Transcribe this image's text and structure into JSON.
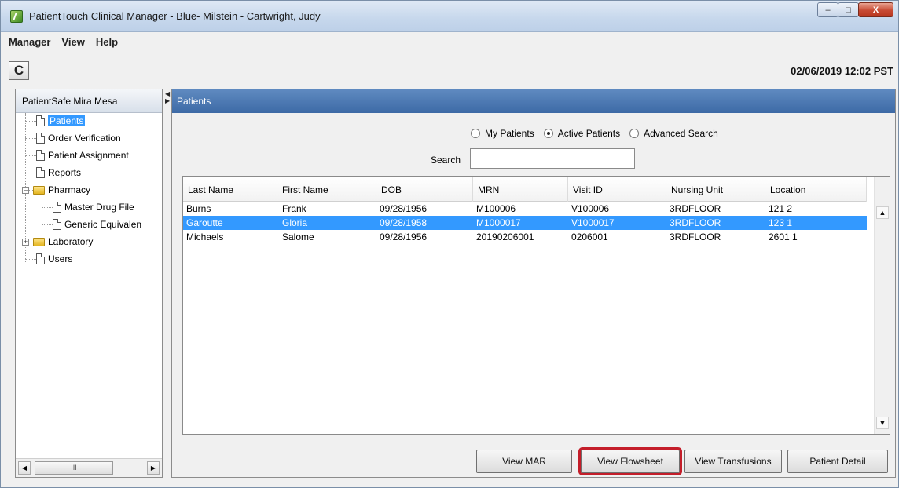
{
  "window": {
    "title": "PatientTouch Clinical Manager - Blue- Milstein - Cartwright, Judy",
    "minimize": "–",
    "maximize": "□",
    "close": "X"
  },
  "menu": {
    "manager": "Manager",
    "view": "View",
    "help": "Help"
  },
  "toolbar": {
    "refresh_glyph": "C",
    "datetime": "02/06/2019 12:02 PST"
  },
  "nav": {
    "header": "PatientSafe Mira Mesa",
    "items": [
      {
        "label": "Patients",
        "selected": true
      },
      {
        "label": "Order Verification"
      },
      {
        "label": "Patient Assignment"
      },
      {
        "label": "Reports"
      },
      {
        "label": "Pharmacy",
        "expander": "–"
      },
      {
        "label": "Master Drug File"
      },
      {
        "label": "Generic Equivalen"
      },
      {
        "label": "Laboratory",
        "expander": "+"
      },
      {
        "label": "Users"
      }
    ],
    "scroll_thumb": "III",
    "scroll_left": "◀",
    "scroll_right": "▶"
  },
  "patients": {
    "header": "Patients",
    "radio": {
      "my_patients": "My Patients",
      "active_patients": "Active Patients",
      "advanced_search": "Advanced Search",
      "selected": "active_patients"
    },
    "search_label": "Search",
    "search_value": "",
    "columns": [
      "Last Name",
      "First Name",
      "DOB",
      "MRN",
      "Visit ID",
      "Nursing Unit",
      "Location"
    ],
    "rows": [
      [
        "Burns",
        "Frank",
        "09/28/1956",
        "M100006",
        "V100006",
        "3RDFLOOR",
        "121 2"
      ],
      [
        "Garoutte",
        "Gloria",
        "09/28/1958",
        "M1000017",
        "V1000017",
        "3RDFLOOR",
        "123 1"
      ],
      [
        "Michaels",
        "Salome",
        "09/28/1956",
        "20190206001",
        "0206001",
        "3RDFLOOR",
        "2601 1"
      ]
    ],
    "selected_row": 1,
    "scroll_up": "▲",
    "scroll_down": "▼"
  },
  "buttons": {
    "view_mar": "View MAR",
    "view_flowsheet": "View Flowsheet",
    "view_transfusions": "View Transfusions",
    "patient_detail": "Patient Detail"
  },
  "colors": {
    "selection": "#3399ff",
    "panel_header": "#4a77b2",
    "highlight_outline": "#c41e2a"
  }
}
